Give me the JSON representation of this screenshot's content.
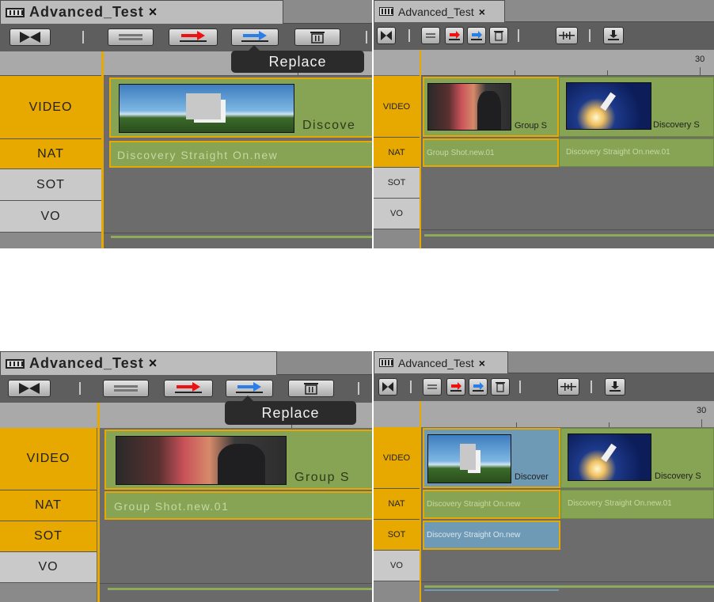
{
  "panels": {
    "top_left": {
      "tab_title": "Advanced_Test",
      "tab_close": "×",
      "tooltip": "Replace",
      "tracks": [
        "VIDEO",
        "NAT",
        "SOT",
        "VO"
      ],
      "clips": {
        "video_label": "Discove",
        "nat_label": "Discovery Straight On.new"
      }
    },
    "top_right": {
      "tab_title": "Advanced_Test",
      "tab_close": "×",
      "ruler_label": "30",
      "tracks": [
        "VIDEO",
        "NAT",
        "SOT",
        "VO"
      ],
      "clips": {
        "video1_label": "Group S",
        "video2_label": "Discovery S",
        "nat1_label": "Group Shot.new.01",
        "nat2_label": "Discovery Straight On.new.01"
      }
    },
    "bottom_left": {
      "tab_title": "Advanced_Test",
      "tab_close": "×",
      "tooltip": "Replace",
      "tracks": [
        "VIDEO",
        "NAT",
        "SOT",
        "VO"
      ],
      "clips": {
        "video_label": "Group S",
        "nat_label": "Group Shot.new.01"
      }
    },
    "bottom_right": {
      "tab_title": "Advanced_Test",
      "tab_close": "×",
      "ruler_label": "30",
      "tracks": [
        "VIDEO",
        "NAT",
        "SOT",
        "VO"
      ],
      "clips": {
        "video1_label": "Discover",
        "video2_label": "Discovery S",
        "nat1_label": "Discovery Straight On.new",
        "nat2_label": "Discovery Straight On.new.01",
        "sot1_label": "Discovery Straight On.new"
      }
    }
  },
  "colors": {
    "track_active": "#e7a800",
    "track_inactive": "#c9c9c9",
    "clip_green": "#86a454",
    "clip_blue": "#6e9ab5",
    "panel_bg": "#6a6a6a"
  },
  "icons": [
    "film-icon",
    "splice-icon",
    "lift-icon",
    "overwrite-icon",
    "replace-icon",
    "delete-icon",
    "audio-mix-icon",
    "send-icon"
  ]
}
